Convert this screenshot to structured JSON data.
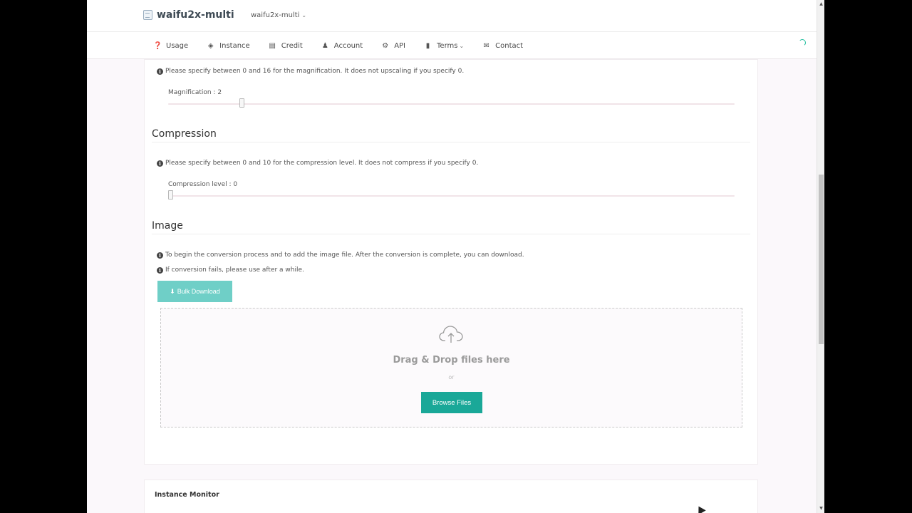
{
  "header": {
    "brand": "waifu2x-multi",
    "site_select": "waifu2x-multi"
  },
  "nav": {
    "items": [
      {
        "label": "Usage",
        "icon": "question-circle-icon"
      },
      {
        "label": "Instance",
        "icon": "cube-icon"
      },
      {
        "label": "Credit",
        "icon": "credit-card-icon"
      },
      {
        "label": "Account",
        "icon": "user-icon"
      },
      {
        "label": "API",
        "icon": "cogs-icon"
      },
      {
        "label": "Terms",
        "icon": "book-icon"
      },
      {
        "label": "Contact",
        "icon": "envelope-icon"
      }
    ]
  },
  "magnification": {
    "info": "Please specify between 0 and 16 for the magnification. It does not upscaling if you specify 0.",
    "label": "Magnification : 2",
    "value": 2,
    "max": 16
  },
  "compression": {
    "title": "Compression",
    "info": "Please specify between 0 and 10 for the compression level. It does not compress if you specify 0.",
    "label": "Compression level : 0",
    "value": 0,
    "max": 10
  },
  "image": {
    "title": "Image",
    "info1": "To begin the conversion process and to add the image file. After the conversion is complete, you can download.",
    "info2": "If conversion fails, please use after a while.",
    "bulk_download_label": "Bulk Download",
    "dropzone_title": "Drag & Drop files here",
    "dropzone_or": "or",
    "browse_label": "Browse Files"
  },
  "instance_monitor": {
    "title": "Instance Monitor"
  },
  "colors": {
    "accent": "#1aa898",
    "accent_light": "#6fcfc7",
    "spinner": "#1abc9c"
  }
}
